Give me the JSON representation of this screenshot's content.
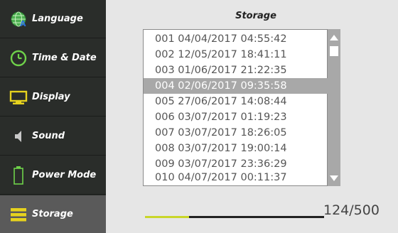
{
  "sidebar": {
    "items": [
      {
        "label": "Language",
        "icon": "globe-icon"
      },
      {
        "label": "Time & Date",
        "icon": "clock-icon"
      },
      {
        "label": "Display",
        "icon": "monitor-icon"
      },
      {
        "label": "Sound",
        "icon": "speaker-icon"
      },
      {
        "label": "Power Mode",
        "icon": "battery-icon"
      },
      {
        "label": "Storage",
        "icon": "storage-icon",
        "selected": true
      }
    ]
  },
  "main": {
    "title": "Storage",
    "records": [
      "001 04/04/2017 04:55:42",
      "002 12/05/2017 18:41:11",
      "003 01/06/2017 21:22:35",
      "004 02/06/2017 09:35:58",
      "005 27/06/2017 14:08:44",
      "006 03/07/2017 01:19:23",
      "007 03/07/2017 18:26:05",
      "008 03/07/2017 19:00:14",
      "009 03/07/2017 23:36:29",
      "010 04/07/2017 00:11:37"
    ],
    "selected_index": 3,
    "storage": {
      "used": 124,
      "total": 500,
      "label": "124/500"
    }
  },
  "colors": {
    "sidebar_bg": "#2a2d2a",
    "sidebar_selected": "#5a5a5a",
    "accent_yellow": "#e6d21e",
    "accent_green": "#6fd24a",
    "progress_fill": "#c9d62a"
  }
}
